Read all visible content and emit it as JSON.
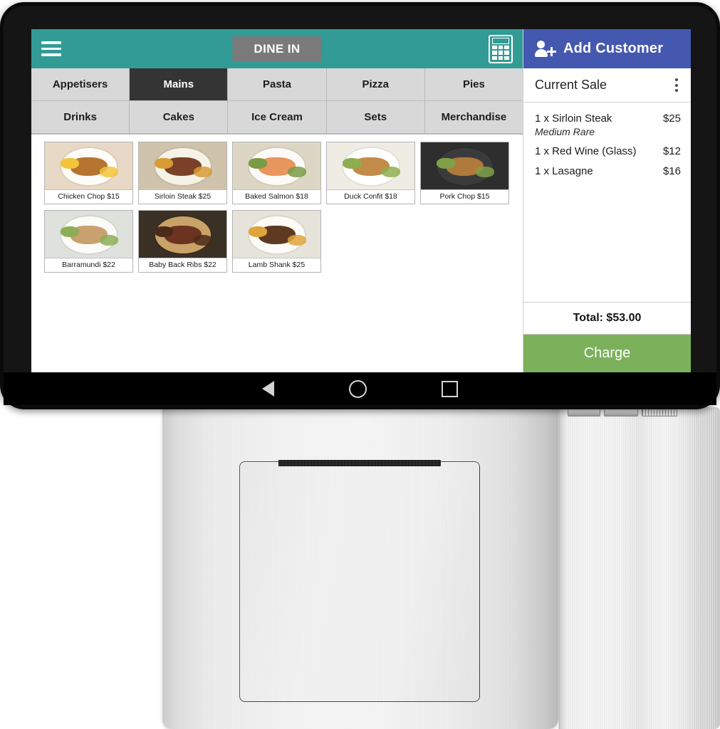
{
  "device": {
    "type": "pos-tablet-with-printer-base",
    "ports": [
      "port-1",
      "port-2",
      "port-3"
    ]
  },
  "top_bar": {
    "menu_icon": "hamburger-icon",
    "order_type_label": "DINE IN",
    "calculator_icon": "calculator-icon"
  },
  "categories": {
    "active": "Mains",
    "row1": [
      "Appetisers",
      "Mains",
      "Pasta",
      "Pizza",
      "Pies"
    ],
    "row2": [
      "Drinks",
      "Cakes",
      "Ice Cream",
      "Sets",
      "Merchandise"
    ]
  },
  "products": [
    {
      "label": "Chicken Chop $15",
      "name": "Chicken Chop",
      "price": "$15",
      "plate": "#fdfcf8",
      "food": "#b5742f",
      "food2": "#f3c33a",
      "bg": "#e8d9c6"
    },
    {
      "label": "Sirloin Steak $25",
      "name": "Sirloin Steak",
      "price": "$25",
      "plate": "#f6f2e6",
      "food": "#7a4128",
      "food2": "#d89b35",
      "bg": "#cfc3ab"
    },
    {
      "label": "Baked Salmon $18",
      "name": "Baked Salmon",
      "price": "$18",
      "plate": "#fbfaf6",
      "food": "#e8955e",
      "food2": "#7a9b45",
      "bg": "#ddd6c4"
    },
    {
      "label": "Duck Confit $18",
      "name": "Duck Confit",
      "price": "$18",
      "plate": "#ffffff",
      "food": "#c08c48",
      "food2": "#8fae50",
      "bg": "#efece4"
    },
    {
      "label": "Pork Chop $15",
      "name": "Pork Chop",
      "price": "$15",
      "plate": "#3b3b3b",
      "food": "#b07a3c",
      "food2": "#7fa047",
      "bg": "#2e2e2e"
    },
    {
      "label": "Barramundi $22",
      "name": "Barramundi",
      "price": "$22",
      "plate": "#fbfbf7",
      "food": "#c9a070",
      "food2": "#8dae56",
      "bg": "#dfe1dc"
    },
    {
      "label": "Baby Back Ribs $22",
      "name": "Baby Back Ribs",
      "price": "$22",
      "plate": "#c9a268",
      "food": "#6b3320",
      "food2": "#4a2a18",
      "bg": "#3a3024"
    },
    {
      "label": "Lamb Shank $25",
      "name": "Lamb Shank",
      "price": "$25",
      "plate": "#fcfbf7",
      "food": "#5f3a22",
      "food2": "#e0a43c",
      "bg": "#e6e3da"
    }
  ],
  "sale_panel": {
    "add_customer_label": "Add Customer",
    "add_customer_icon": "person-add-icon",
    "current_sale_title": "Current Sale",
    "overflow_icon": "more-vertical-icon",
    "items": [
      {
        "name": "1 x Sirloin Steak",
        "price": "$25",
        "note": "Medium Rare"
      },
      {
        "name": "1 x Red Wine (Glass)",
        "price": "$12",
        "note": ""
      },
      {
        "name": "1 x Lasagne",
        "price": "$16",
        "note": ""
      }
    ],
    "total_label": "Total: $53.00",
    "charge_label": "Charge"
  },
  "android_nav": {
    "back_icon": "back-triangle-icon",
    "home_icon": "home-circle-icon",
    "recents_icon": "recents-square-icon"
  },
  "colors": {
    "teal_header": "#329b96",
    "dine_in_button": "#7a7a7a",
    "tab_inactive": "#d8d8d8",
    "tab_active": "#343434",
    "customer_blue": "#4458b0",
    "charge_green": "#7cb15b"
  }
}
